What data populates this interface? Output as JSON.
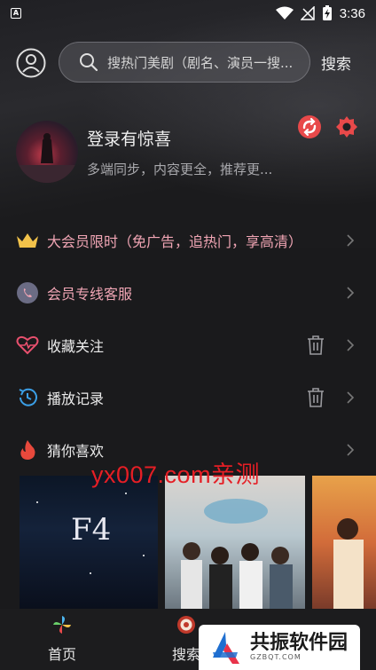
{
  "status_bar": {
    "time": "3:36",
    "app_icon_letter": "A"
  },
  "header": {
    "search_placeholder": "搜热门美剧（剧名、演员一搜...",
    "search_button": "搜索"
  },
  "user": {
    "title": "登录有惊喜",
    "subtitle": "多端同步，内容更全，推荐更..."
  },
  "menu": {
    "vip": "大会员限时（免广告，追热门，享高清）",
    "service": "会员专线客服",
    "favorites": "收藏关注",
    "history": "播放记录",
    "guess": "猜你喜欢"
  },
  "watermark": "yx007.com亲测",
  "posters": [
    {
      "title": "F4"
    },
    {
      "title": ""
    },
    {
      "title": ""
    }
  ],
  "bottom_nav": {
    "home": "首页",
    "search": "搜索"
  },
  "brand": {
    "name": "共振软件园",
    "domain": "GZBQT.COM"
  },
  "colors": {
    "accent_red": "#e8494a",
    "vip_gold": "#f2c24a",
    "vip_pink": "#f0a5b4",
    "watermark_red": "#e51e25"
  }
}
